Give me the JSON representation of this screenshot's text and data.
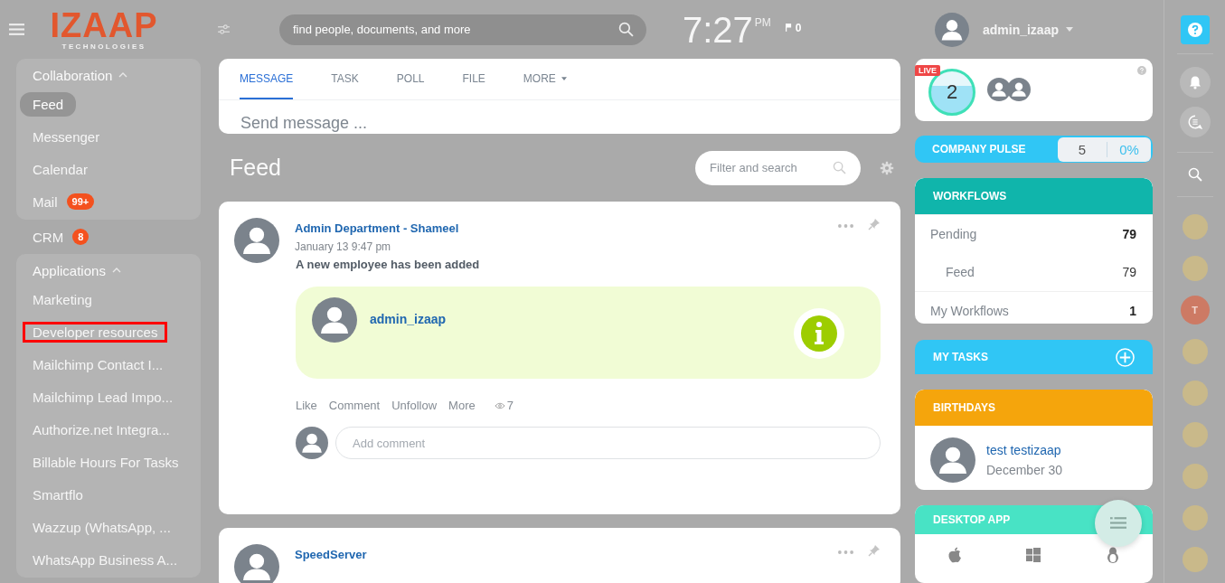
{
  "logo": {
    "name": "IZAAP",
    "tagline": "TECHNOLOGIES"
  },
  "header": {
    "search": {
      "placeholder": "find people, documents, and more"
    },
    "time": "7:27",
    "meridiem": "PM",
    "flag_count": "0",
    "user": "admin_izaap"
  },
  "sidebar": {
    "sections": [
      {
        "kind": "group",
        "title": "Collaboration",
        "expanded": true,
        "items": [
          {
            "label": "Feed",
            "selected": true,
            "outlined": false
          },
          {
            "label": "Messenger",
            "selected": false,
            "outlined": false
          },
          {
            "label": "Calendar",
            "selected": false,
            "outlined": false
          },
          {
            "label": "Mail",
            "badge": "99+",
            "selected": false,
            "outlined": false
          }
        ]
      },
      {
        "kind": "item",
        "label": "CRM",
        "badge": "8",
        "selected": false,
        "outlined": false
      },
      {
        "kind": "group",
        "title": "Applications",
        "expanded": true,
        "items": [
          {
            "label": "Marketing",
            "selected": false,
            "outlined": false
          },
          {
            "label": "Developer resources",
            "selected": false,
            "outlined": true
          },
          {
            "label": "Mailchimp Contact I...",
            "selected": false,
            "outlined": false
          },
          {
            "label": "Mailchimp Lead Impo...",
            "selected": false,
            "outlined": false
          },
          {
            "label": "Authorize.net Integra...",
            "selected": false,
            "outlined": false
          },
          {
            "label": "Billable Hours For Tasks",
            "selected": false,
            "outlined": false
          },
          {
            "label": "Smartflo",
            "selected": false,
            "outlined": false
          },
          {
            "label": "Wazzup (WhatsApp, ...",
            "selected": false,
            "outlined": false
          },
          {
            "label": "WhatsApp Business A...",
            "selected": false,
            "outlined": false
          }
        ]
      }
    ]
  },
  "composer": {
    "tabs": [
      {
        "label": "MESSAGE",
        "selected": true,
        "dropdown": false
      },
      {
        "label": "TASK",
        "selected": false,
        "dropdown": false
      },
      {
        "label": "POLL",
        "selected": false,
        "dropdown": false
      },
      {
        "label": "FILE",
        "selected": false,
        "dropdown": false
      },
      {
        "label": "MORE",
        "selected": false,
        "dropdown": true
      }
    ],
    "placeholder": "Send message ..."
  },
  "feed": {
    "title": "Feed",
    "filter": {
      "placeholder": "Filter and search"
    },
    "posts": [
      {
        "author": "Admin Department - Shameel",
        "date": "January 13 9:47 pm",
        "text": "A new employee has been added",
        "employee": "admin_izaap",
        "actions": [
          "Like",
          "Comment",
          "Unfollow",
          "More"
        ],
        "views": "7",
        "comment_placeholder": "Add comment"
      },
      {
        "author": "SpeedServer"
      }
    ]
  },
  "widgets": {
    "live": {
      "badge": "LIVE",
      "count": "2"
    },
    "pulse": {
      "title": "COMPANY PULSE",
      "count": "5",
      "percent": "0%"
    },
    "workflows": {
      "title": "WORKFLOWS",
      "rows": [
        {
          "label": "Pending",
          "value": "79",
          "children": [
            {
              "label": "Feed",
              "value": "79"
            }
          ]
        },
        {
          "label": "My Workflows",
          "value": "1"
        }
      ]
    },
    "tasks": {
      "title": "MY TASKS"
    },
    "birthdays": {
      "title": "BIRTHDAYS",
      "people": [
        {
          "name": "test testizaap",
          "date": "December 30"
        }
      ]
    },
    "desktop_app": {
      "title": "DESKTOP APP"
    }
  },
  "rail": {
    "avatars": [
      {
        "kind": "photo"
      },
      {
        "kind": "photo"
      },
      {
        "kind": "initial",
        "initial": "T"
      },
      {
        "kind": "photo"
      },
      {
        "kind": "photo"
      },
      {
        "kind": "photo"
      },
      {
        "kind": "photo"
      },
      {
        "kind": "photo"
      },
      {
        "kind": "photo"
      }
    ]
  }
}
